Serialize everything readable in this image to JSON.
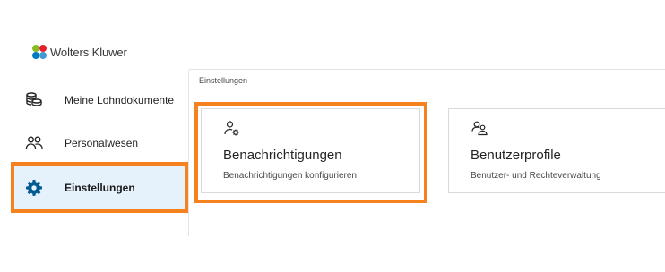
{
  "brand": {
    "name": "Wolters Kluwer",
    "colors": [
      "#85bc20",
      "#e5202e",
      "#007ac3",
      "#409bd2"
    ]
  },
  "sidebar": {
    "items": [
      {
        "label": "Meine Lohndokumente",
        "icon": "coins-icon",
        "active": false
      },
      {
        "label": "Personalwesen",
        "icon": "users-icon",
        "active": false
      },
      {
        "label": "Einstellungen",
        "icon": "gear-icon",
        "active": true
      }
    ]
  },
  "breadcrumb": "Einstellungen",
  "tiles": [
    {
      "title": "Benachrichtigungen",
      "subtitle": "Benachrichtigungen konfigurieren",
      "icon": "user-gear-icon",
      "highlighted": true
    },
    {
      "title": "Benutzerprofile",
      "subtitle": "Benutzer- und Rechteverwaltung",
      "icon": "user-profiles-icon",
      "highlighted": false
    }
  ],
  "colors": {
    "accent": "#f5811f",
    "active_bg": "#e5f2fc",
    "active_icon": "#005b92"
  }
}
